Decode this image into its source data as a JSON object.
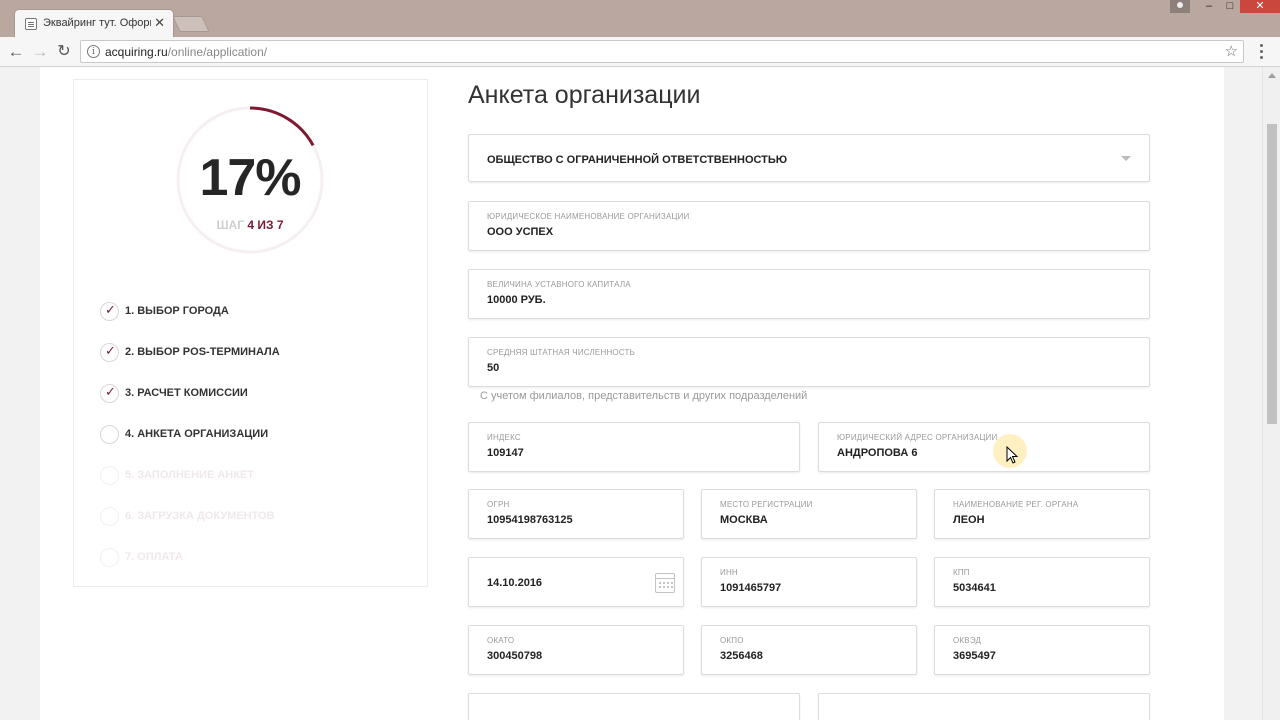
{
  "browser": {
    "tab_title": "Эквайринг тут. Оформле",
    "tab_close": "✕",
    "url_domain": "acquiring.ru",
    "url_path": "/online/application/",
    "window_min": "–",
    "window_max": "□",
    "window_close": "✕"
  },
  "sidebar": {
    "progress_percent": "17%",
    "progress_value": 0.17,
    "step_prefix": "ШАГ",
    "step_current": "4 ИЗ 7",
    "steps": [
      {
        "label": "1. ВЫБОР ГОРОДА",
        "status": "done"
      },
      {
        "label": "2. ВЫБОР POS-ТЕРМИНАЛА",
        "status": "done"
      },
      {
        "label": "3. РАСЧЕТ КОМИССИИ",
        "status": "done"
      },
      {
        "label": "4. АНКЕТА ОРГАНИЗАЦИИ",
        "status": "current"
      },
      {
        "label": "5. ЗАПОЛНЕНИЕ АНКЕТ",
        "status": "todo"
      },
      {
        "label": "6. ЗАГРУЗКА ДОКУМЕНТОВ",
        "status": "todo"
      },
      {
        "label": "7. ОПЛАТА",
        "status": "todo"
      }
    ]
  },
  "form": {
    "title": "Анкета организации",
    "org_type": "ОБЩЕСТВО С ОГРАНИЧЕННОЙ ОТВЕТСТВЕННОСТЬЮ",
    "legal_name": {
      "label": "ЮРИДИЧЕСКОЕ НАИМЕНОВАНИЕ ОРГАНИЗАЦИИ",
      "value": "ООО УСПЕХ"
    },
    "capital": {
      "label": "ВЕЛИЧИНА УСТАВНОГО КАПИТАЛА",
      "value": "10000 РУБ."
    },
    "headcount": {
      "label": "СРЕДНЯЯ ШТАТНАЯ ЧИСЛЕННОСТЬ",
      "value": "50"
    },
    "headcount_hint": "С учетом филиалов, представительств и других подразделений",
    "index": {
      "label": "ИНДЕКС",
      "value": "109147"
    },
    "legal_address": {
      "label": "ЮРИДИЧЕСКИЙ АДРЕС ОРГАНИЗАЦИИ",
      "value": "АНДРОПОВА 6"
    },
    "ogrn": {
      "label": "ОГРН",
      "value": "10954198763125"
    },
    "reg_place": {
      "label": "МЕСТО РЕГИСТРАЦИИ",
      "value": "МОСКВА"
    },
    "reg_authority": {
      "label": "НАИМЕНОВАНИЕ РЕГ. ОРГАНА",
      "value": "ЛЕОН"
    },
    "reg_date": {
      "value": "14.10.2016"
    },
    "inn": {
      "label": "ИНН",
      "value": "1091465797"
    },
    "kpp": {
      "label": "КПП",
      "value": "5034641"
    },
    "okato": {
      "label": "ОКАТО",
      "value": "300450798"
    },
    "okpo": {
      "label": "ОКПО",
      "value": "3256468"
    },
    "okved": {
      "label": "ОКВЭД",
      "value": "3695497"
    }
  }
}
